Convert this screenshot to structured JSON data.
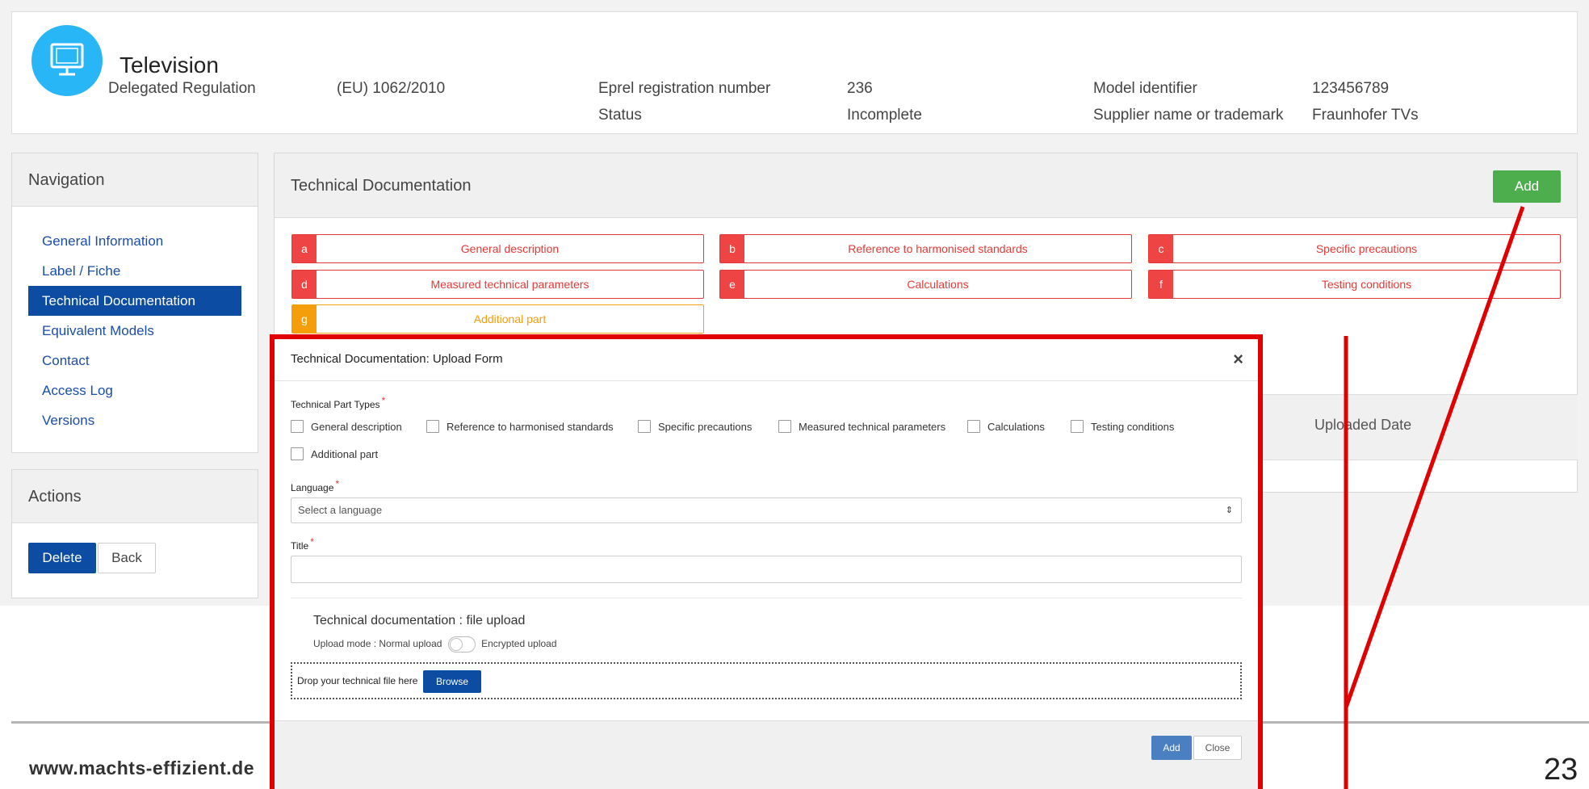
{
  "header": {
    "title": "Television",
    "fields": [
      {
        "label": "Delegated Regulation",
        "value": "(EU) 1062/2010"
      },
      {
        "label": "Eprel registration number",
        "value": "236"
      },
      {
        "label": "Status",
        "value": "Incomplete"
      },
      {
        "label": "Model identifier",
        "value": "123456789"
      },
      {
        "label": "Supplier name or trademark",
        "value": "Fraunhofer TVs"
      }
    ],
    "icon": "monitor-icon",
    "icon_color": "#29b6f6"
  },
  "navigation": {
    "title": "Navigation",
    "items": [
      {
        "label": "General Information"
      },
      {
        "label": "Label / Fiche"
      },
      {
        "label": "Technical Documentation"
      },
      {
        "label": "Equivalent Models"
      },
      {
        "label": "Contact"
      },
      {
        "label": "Access Log"
      },
      {
        "label": "Versions"
      }
    ],
    "active": "Technical Documentation"
  },
  "actions": {
    "title": "Actions",
    "delete_label": "Delete",
    "back_label": "Back"
  },
  "main": {
    "title": "Technical Documentation",
    "add_label": "Add",
    "parts": [
      {
        "letter": "a",
        "label": "General description"
      },
      {
        "letter": "b",
        "label": "Reference to harmonised standards"
      },
      {
        "letter": "c",
        "label": "Specific precautions"
      },
      {
        "letter": "d",
        "label": "Measured technical parameters"
      },
      {
        "letter": "e",
        "label": "Calculations"
      },
      {
        "letter": "f",
        "label": "Testing conditions"
      },
      {
        "letter": "g",
        "label": "Additional part"
      }
    ],
    "table_column_uploaded_date": "Uploaded Date"
  },
  "modal": {
    "title": "Technical Documentation: Upload Form",
    "close_glyph": "×",
    "part_types_label": "Technical Part Types",
    "part_types": [
      "General description",
      "Reference to harmonised standards",
      "Specific precautions",
      "Measured technical parameters",
      "Calculations",
      "Testing conditions",
      "Additional part"
    ],
    "required_marker": "*",
    "language_label": "Language",
    "language_placeholder": "Select a language",
    "select_arrow": "⇕",
    "title_label": "Title",
    "upload_title": "Technical documentation : file upload",
    "upload_mode_label": "Upload mode :",
    "upload_mode_normal": "Normal upload",
    "upload_mode_encrypted": "Encrypted upload",
    "drop_text": "Drop your technical file here",
    "browse_label": "Browse",
    "add_label": "Add",
    "close_label": "Close"
  },
  "footer": {
    "url": "www.machts-effizient.de",
    "page_number": "23"
  },
  "colors": {
    "primary": "#0d4ca3",
    "success": "#4cae4c",
    "danger": "#ef4444",
    "warning": "#f59e0b",
    "annotation": "#e00000"
  }
}
